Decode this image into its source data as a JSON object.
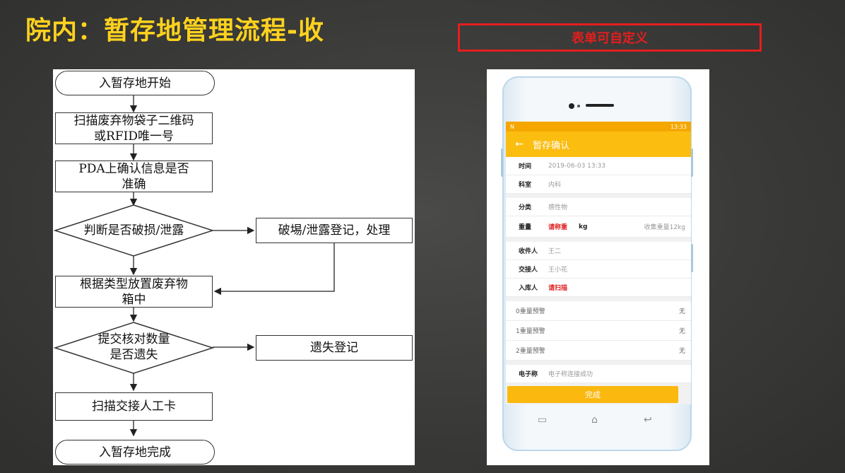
{
  "slide": {
    "title": "院内：暂存地管理流程-收",
    "custom_label": "表单可自定义"
  },
  "flowchart": {
    "start": "入暂存地开始",
    "scan_line1": "扫描废弃物袋子二维码",
    "scan_line2": "或RFID唯一号",
    "pda_line1": "PDA上确认信息是否",
    "pda_line2": "准确",
    "decision_damage": "判断是否破损/泄露",
    "damage_register": "破埸/泄露登记，处理",
    "place_line1": "根据类型放置废弃物",
    "place_line2": "箱中",
    "decision_count_line1": "提交核对数量",
    "decision_count_line2": "是否遗失",
    "loss_register": "遗失登记",
    "scan_card": "扫描交接人工卡",
    "end": "入暂存地完成"
  },
  "phone": {
    "status_time": "13:33",
    "status_left": "N",
    "appbar_title": "暂存确认",
    "fields": {
      "time_label": "时间",
      "time_value": "2019-06-03 13:33",
      "dept_label": "科室",
      "dept_value": "内科",
      "category_label": "分类",
      "category_value": "感性物",
      "weight_label": "重量",
      "weight_value": "请称重",
      "weight_unit": "kg",
      "weight_collected": "收集重量12kg",
      "receiver_label": "收件人",
      "receiver_value": "王二",
      "handover_label": "交接人",
      "handover_value": "王小花",
      "storage_label": "入库人",
      "storage_value": "请扫描"
    },
    "warnings": [
      {
        "label": "0重量预警",
        "value": "无"
      },
      {
        "label": "1重量预警",
        "value": "无"
      },
      {
        "label": "2重量预警",
        "value": "无"
      }
    ],
    "scale_label": "电子称",
    "scale_value": "电子称连接成功",
    "done_button": "完成"
  }
}
